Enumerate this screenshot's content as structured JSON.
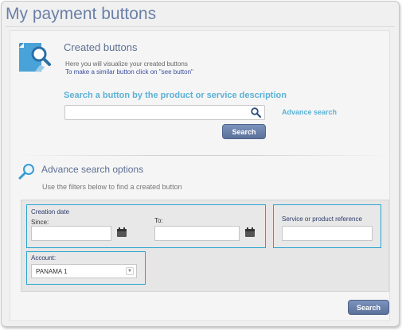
{
  "page": {
    "title": "My payment buttons"
  },
  "created": {
    "title": "Created buttons",
    "desc_line1": "Here you will visualize your created buttons",
    "desc_line2": "To make a similar button click on \"see button\""
  },
  "search": {
    "label": "Search a button by the product or service description",
    "value": "",
    "advanced_link": "Advance search",
    "button_label": "Search"
  },
  "advanced": {
    "title": "Advance search options",
    "desc": "Use the filters below to find a created button",
    "creation_date_label": "Creation date",
    "since_label": "Since:",
    "to_label": "To:",
    "since_value": "",
    "to_value": "",
    "reference_label": "Service or product reference",
    "reference_value": "",
    "account_label": "Account:",
    "account_selected": "PANAMA 1",
    "search_button": "Search"
  }
}
